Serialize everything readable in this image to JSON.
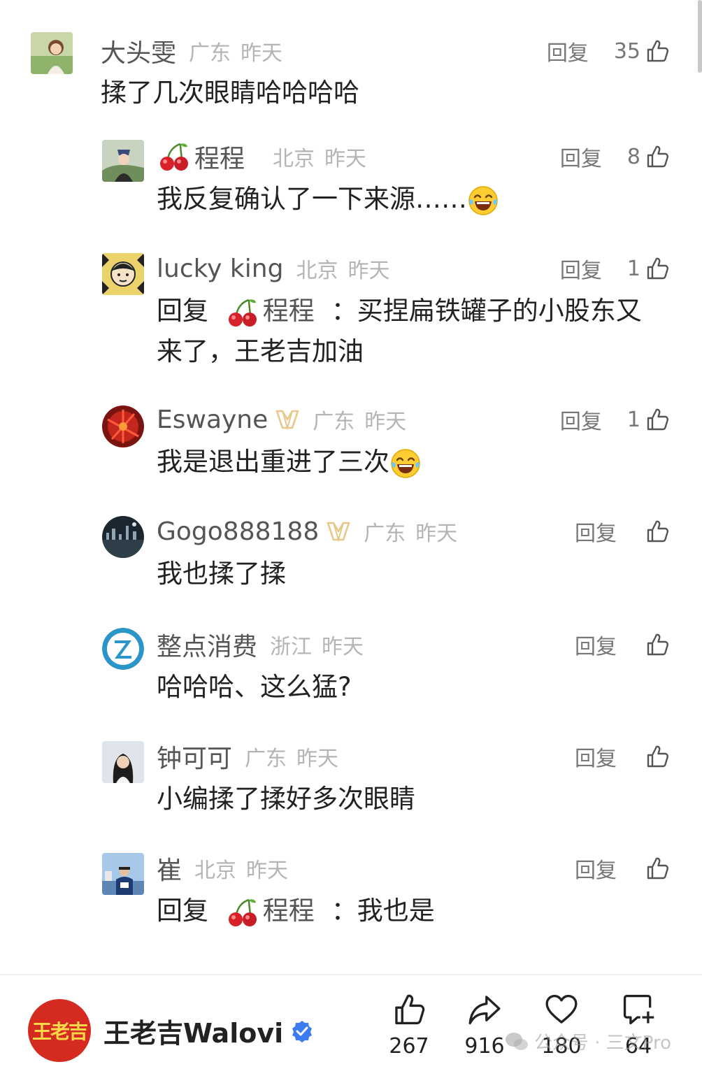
{
  "actions": {
    "reply_label": "回复"
  },
  "comments": [
    {
      "name": "大头雯",
      "region": "广东",
      "time": "昨天",
      "likes": "35",
      "text": "揉了几次眼睛哈哈哈哈"
    },
    {
      "name": "程程",
      "region": "北京",
      "time": "昨天",
      "likes": "8",
      "text": "我反复确认了一下来源……"
    },
    {
      "name": "lucky king",
      "region": "北京",
      "time": "昨天",
      "likes": "1",
      "reply_prefix": "回复",
      "mention": "程程",
      "text_line1": "：买捏扁铁罐子的小股东又",
      "text_line2": "来了，王老吉加油"
    },
    {
      "name": "Eswayne",
      "region": "广东",
      "time": "昨天",
      "likes": "1",
      "text": "我是退出重进了三次"
    },
    {
      "name": "Gogo888188",
      "region": "广东",
      "time": "昨天",
      "likes": "",
      "text": "我也揉了揉"
    },
    {
      "name": "整点消费",
      "region": "浙江",
      "time": "昨天",
      "likes": "",
      "text": "哈哈哈、这么猛?"
    },
    {
      "name": "钟可可",
      "region": "广东",
      "time": "昨天",
      "likes": "",
      "text": "小编揉了揉好多次眼睛"
    },
    {
      "name": "崔",
      "region": "北京",
      "time": "昨天",
      "likes": "",
      "reply_prefix": "回复",
      "mention": "程程",
      "text": "：我也是"
    }
  ],
  "footer": {
    "brand_logo_text": "王老吉",
    "brand_name": "王老吉Walovi",
    "likes": "267",
    "shares": "916",
    "favorites": "180",
    "comments": "64",
    "watermark": "公众号 · 三文Pro"
  },
  "icons": {
    "like": "thumbs-up-icon",
    "share": "share-arrow-icon",
    "favorite": "heart-icon",
    "comment": "comment-add-icon",
    "verified": "verified-badge-icon",
    "vip": "vip-badge-icon",
    "cherry": "cherry-emoji",
    "laugh": "laughing-emoji"
  },
  "colors": {
    "accent_blue": "#3d7cf0",
    "brand_red": "#d42a20",
    "vip_gold": "#e8c88a"
  }
}
